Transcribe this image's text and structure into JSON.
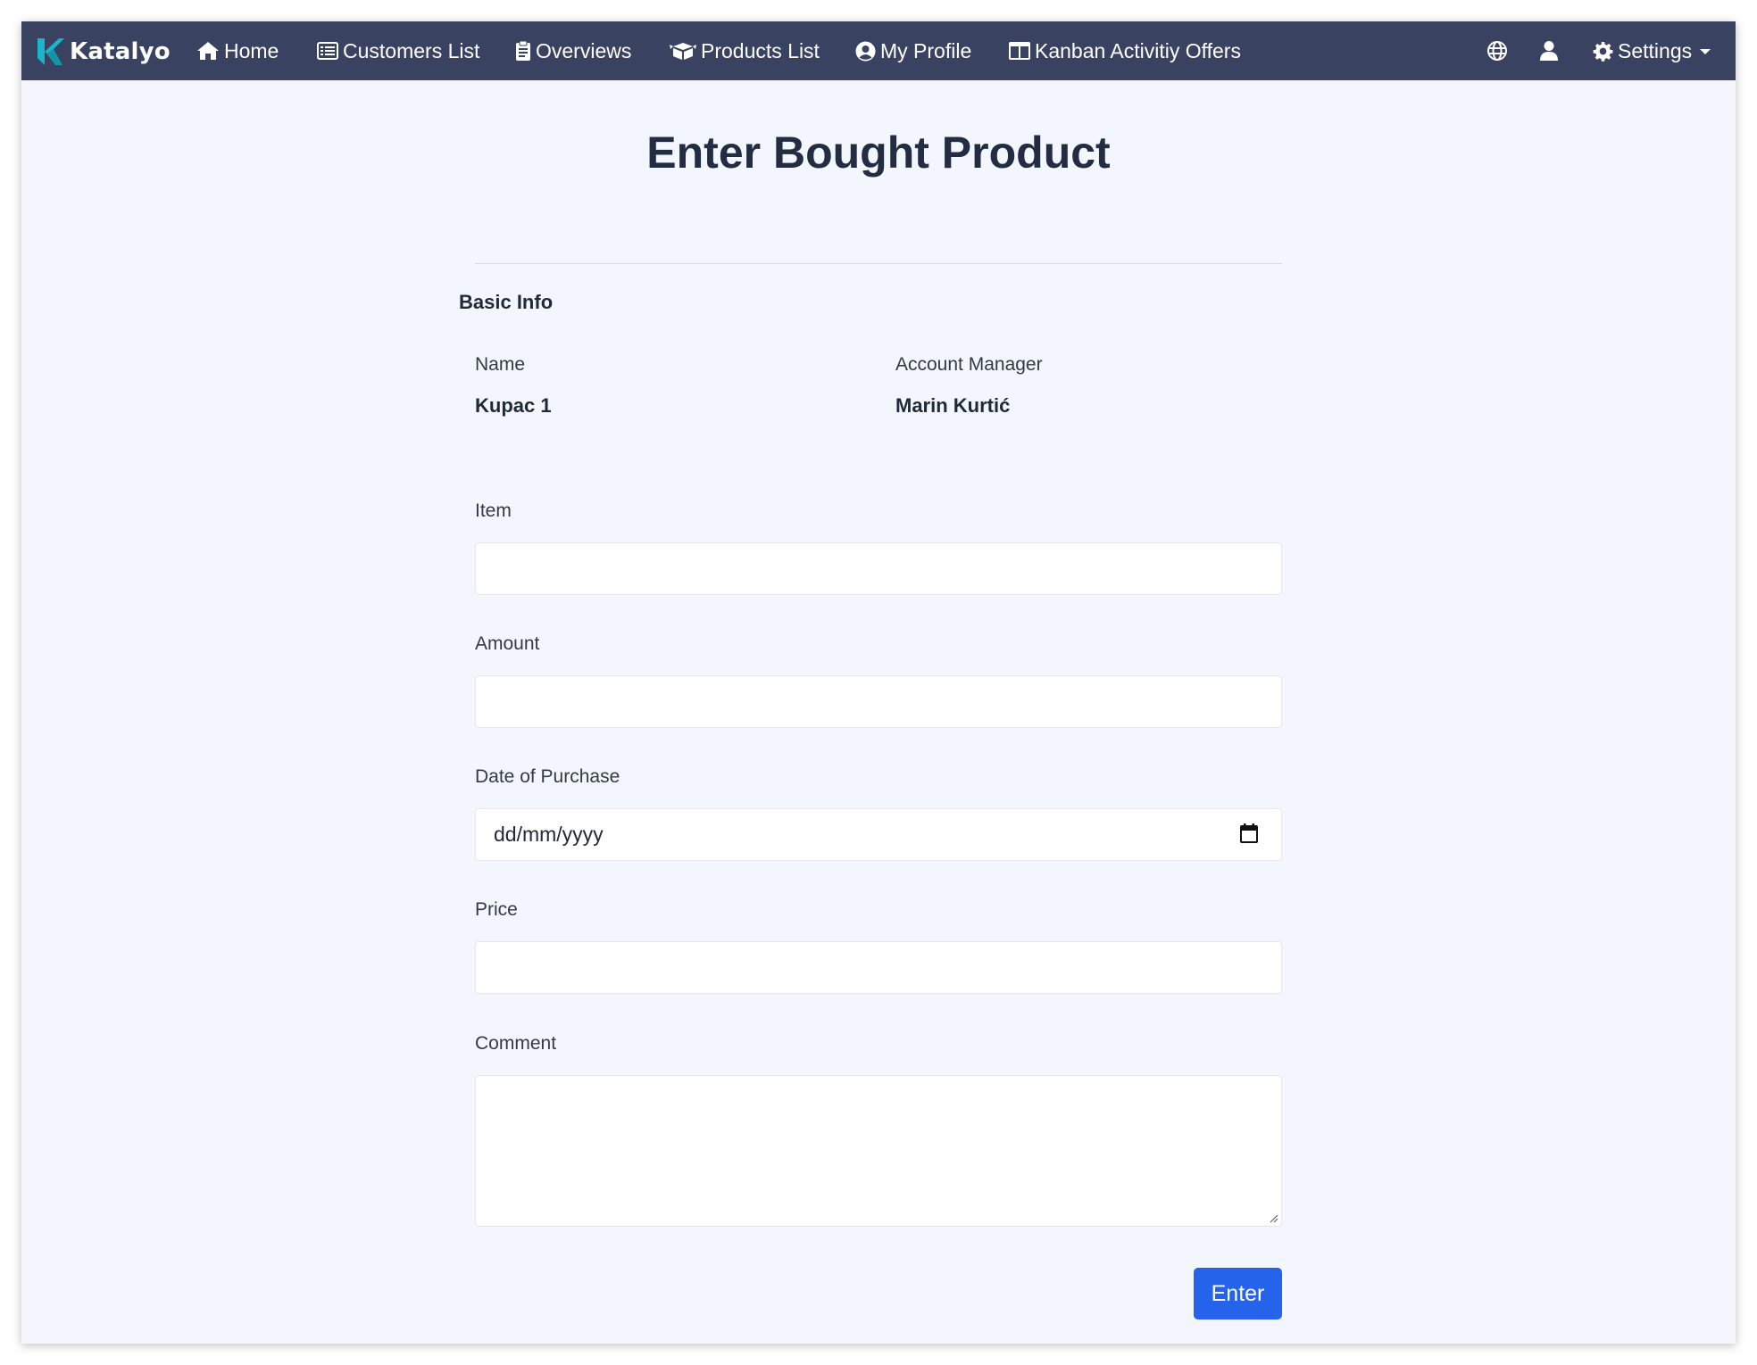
{
  "navbar": {
    "brand": "Katalyo",
    "links": [
      {
        "label": "Home",
        "icon": "home-icon"
      },
      {
        "label": "Customers List",
        "icon": "list-icon"
      },
      {
        "label": "Overviews",
        "icon": "clipboard-icon"
      },
      {
        "label": "Products List",
        "icon": "box-icon"
      },
      {
        "label": "My Profile",
        "icon": "user-circle-icon"
      },
      {
        "label": "Kanban Activitiy Offers",
        "icon": "columns-icon"
      }
    ],
    "right": {
      "language_icon": "globe-icon",
      "user_icon": "user-icon",
      "settings_label": "Settings",
      "settings_icon": "gear-icon"
    },
    "colors": {
      "background": "#3a4262",
      "brand_accent": "#1bb5c9"
    }
  },
  "page": {
    "title": "Enter Bought Product"
  },
  "basic_info": {
    "heading": "Basic Info",
    "name_label": "Name",
    "name_value": "Kupac 1",
    "manager_label": "Account Manager",
    "manager_value": "Marin Kurtić"
  },
  "form": {
    "item_label": "Item",
    "item_value": "",
    "amount_label": "Amount",
    "amount_value": "",
    "date_label": "Date of Purchase",
    "date_placeholder": "dd/mm/yyyy",
    "price_label": "Price",
    "price_value": "",
    "comment_label": "Comment",
    "comment_value": "",
    "submit_label": "Enter",
    "submit_color": "#2563eb"
  }
}
